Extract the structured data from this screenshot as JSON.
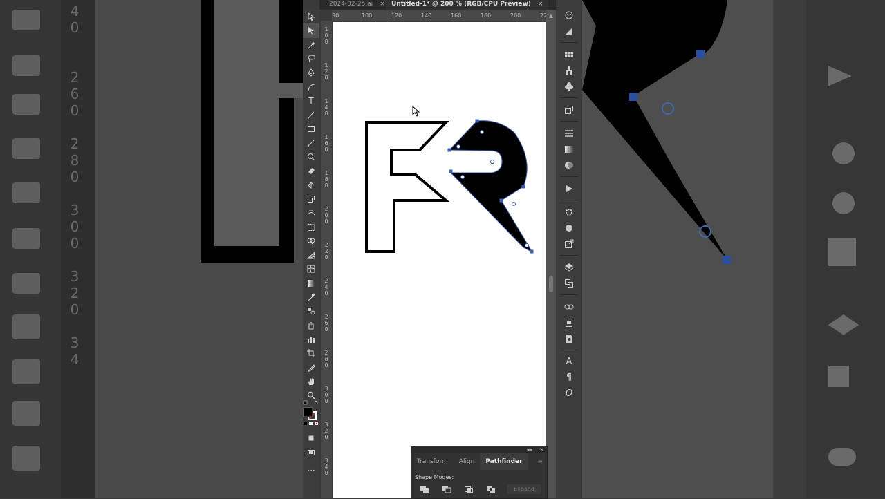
{
  "document_tabs": [
    {
      "label": "2024-02-25.ai",
      "close": "×"
    },
    {
      "label": "Untitled-1* @ 200 % (RGB/CPU Preview)",
      "close": "×"
    }
  ],
  "ruler_top": [
    "30",
    "100",
    "120",
    "140",
    "160",
    "180",
    "200",
    "22"
  ],
  "ruler_side": [
    "1\n0\n0",
    "1\n2\n0",
    "1\n4\n0",
    "1\n6\n0",
    "1\n8\n0",
    "2\n0\n0",
    "2\n2\n0",
    "2\n4\n0",
    "2\n6\n0",
    "2\n8\n0",
    "3\n0\n0",
    "3\n2\n0",
    "3\n4\n0"
  ],
  "bg_left_digits": "4\n0\n\n\n2\n6\n0\n\n2\n8\n0\n\n3\n0\n0\n\n3\n2\n0\n\n3\n4",
  "tools": [
    "selection-tool",
    "direct-selection-tool",
    "magic-wand-tool",
    "lasso-tool",
    "pen-tool",
    "curvature-tool",
    "type-tool",
    "line-segment-tool",
    "rectangle-tool",
    "paintbrush-tool",
    "shaper-tool",
    "eraser-tool",
    "rotate-tool",
    "scale-tool",
    "width-tool",
    "free-transform-tool",
    "shape-builder-tool",
    "perspective-grid-tool",
    "mesh-tool",
    "gradient-tool",
    "eyedropper-tool",
    "blend-tool",
    "symbol-sprayer-tool",
    "column-graph-tool",
    "artboard-tool",
    "slice-tool",
    "hand-tool",
    "zoom-tool"
  ],
  "type_tool_glyph": "T",
  "right_panel_icons": [
    "color-icon",
    "color-guide-icon",
    "swatches-icon",
    "brushes-icon",
    "symbols-icon",
    "asset-export-icon",
    "stroke-icon",
    "gradient-icon",
    "transparency-icon",
    "actions-icon",
    "appearance-icon",
    "graphic-styles-icon",
    "export-icon",
    "layers-icon",
    "artboards-icon",
    "links-icon",
    "libraries-icon",
    "document-info-icon",
    "character-icon",
    "paragraph-icon",
    "opentype-icon"
  ],
  "character_glyph": "A",
  "paragraph_glyph": "¶",
  "opentype_glyph": "O",
  "pathfinder": {
    "tabs": [
      "Transform",
      "Align",
      "Pathfinder"
    ],
    "active_tab": "Pathfinder",
    "collapse": "◂◂",
    "close": "×",
    "menu": "≡",
    "shape_modes_label": "Shape Modes:",
    "expand_label": "Expand"
  },
  "toolbar_more": "···"
}
